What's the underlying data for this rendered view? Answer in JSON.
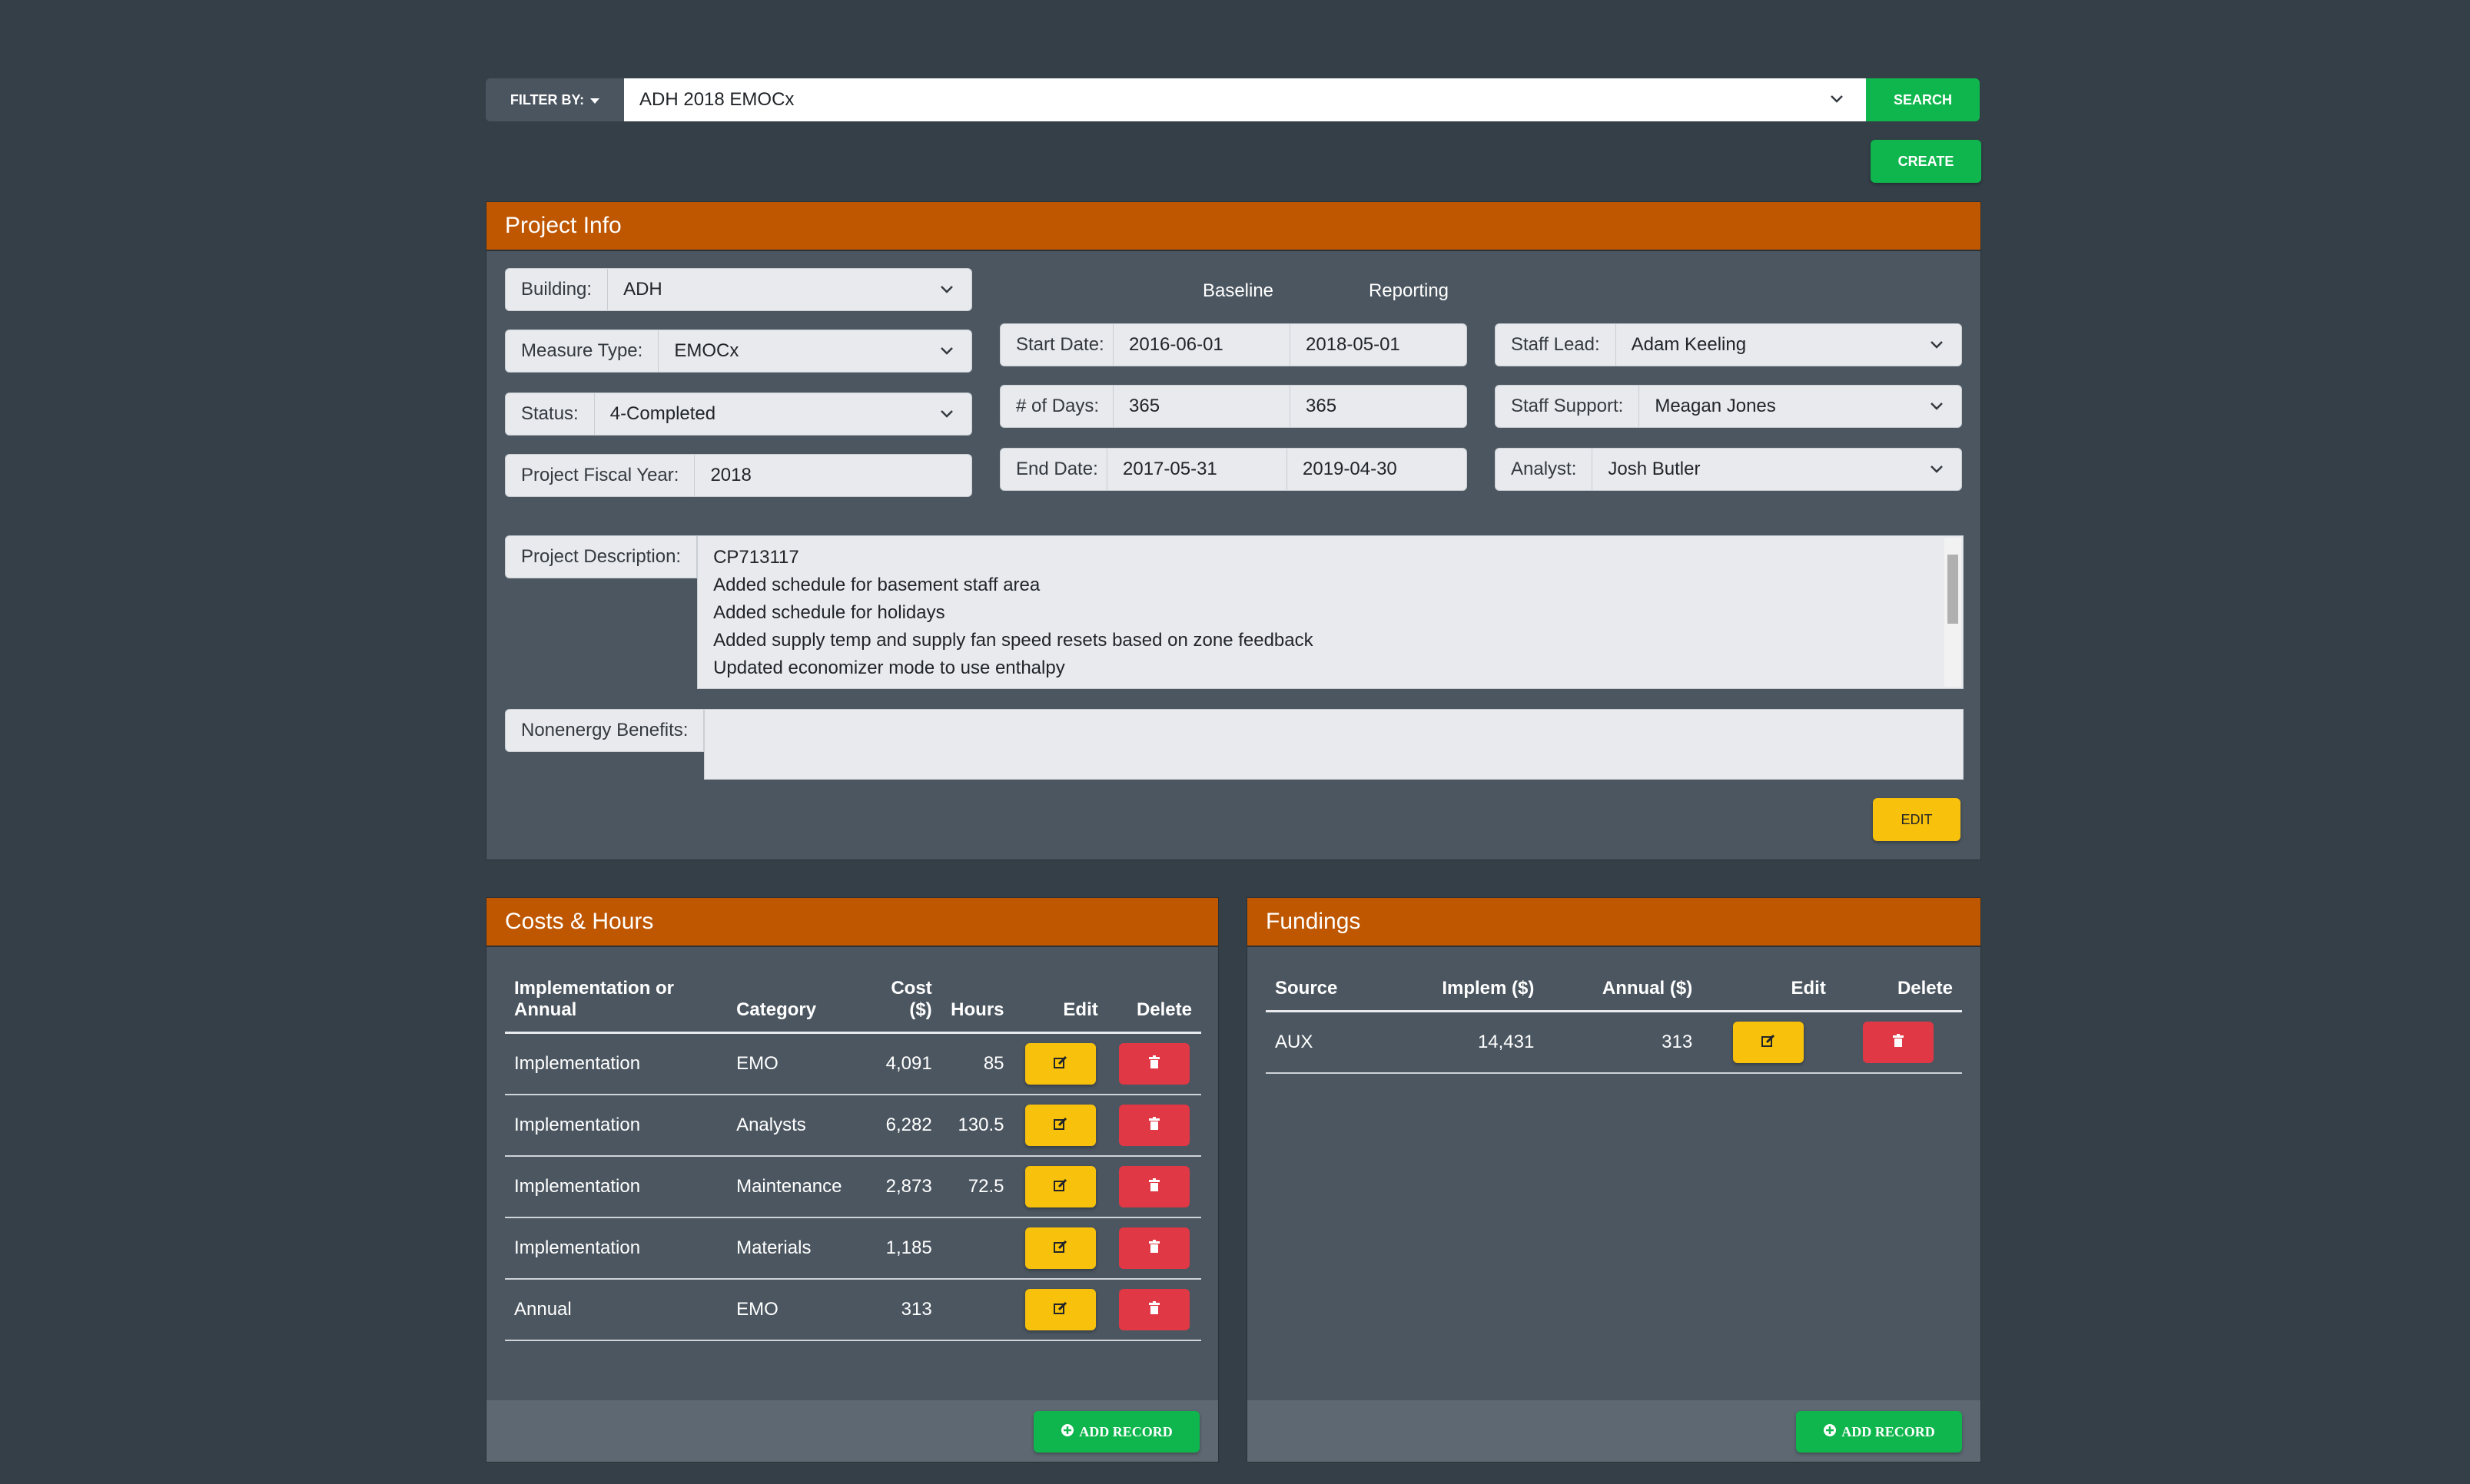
{
  "filter": {
    "label": "FILTER BY:",
    "value": "ADH 2018 EMOCx",
    "search_label": "SEARCH",
    "create_label": "CREATE"
  },
  "project_info": {
    "title": "Project Info",
    "building_label": "Building:",
    "building": "ADH",
    "measure_type_label": "Measure Type:",
    "measure_type": "EMOCx",
    "status_label": "Status:",
    "status": "4-Completed",
    "fiscal_year_label": "Project Fiscal Year:",
    "fiscal_year": "2018",
    "baseline_header": "Baseline",
    "reporting_header": "Reporting",
    "start_date_label": "Start Date:",
    "start_baseline": "2016-06-01",
    "start_reporting": "2018-05-01",
    "days_label": "# of Days:",
    "days_baseline": "365",
    "days_reporting": "365",
    "end_date_label": "End Date:",
    "end_baseline": "2017-05-31",
    "end_reporting": "2019-04-30",
    "staff_lead_label": "Staff Lead:",
    "staff_lead": "Adam Keeling",
    "staff_support_label": "Staff Support:",
    "staff_support": "Meagan Jones",
    "analyst_label": "Analyst:",
    "analyst": "Josh Butler",
    "description_label": "Project Description:",
    "description_lines": [
      "CP713117",
      "Added schedule for basement staff area",
      "Added schedule for holidays",
      "Added supply temp and supply fan speed resets based on zone feedback",
      "Updated economizer mode to use enthalpy"
    ],
    "nonenergy_label": "Nonenergy Benefits:",
    "nonenergy": "",
    "edit_label": "EDIT"
  },
  "costs": {
    "title": "Costs & Hours",
    "headers": [
      "Implementation or Annual",
      "Category",
      "Cost ($)",
      "Hours",
      "Edit",
      "Delete"
    ],
    "rows": [
      {
        "type": "Implementation",
        "category": "EMO",
        "cost": "4,091",
        "hours": "85"
      },
      {
        "type": "Implementation",
        "category": "Analysts",
        "cost": "6,282",
        "hours": "130.5"
      },
      {
        "type": "Implementation",
        "category": "Maintenance",
        "cost": "2,873",
        "hours": "72.5"
      },
      {
        "type": "Implementation",
        "category": "Materials",
        "cost": "1,185",
        "hours": ""
      },
      {
        "type": "Annual",
        "category": "EMO",
        "cost": "313",
        "hours": ""
      }
    ],
    "add_label": "ADD RECORD"
  },
  "fundings": {
    "title": "Fundings",
    "headers": [
      "Source",
      "Implem ($)",
      "Annual ($)",
      "Edit",
      "Delete"
    ],
    "rows": [
      {
        "source": "AUX",
        "implem": "14,431",
        "annual": "313"
      }
    ],
    "add_label": "ADD RECORD"
  },
  "colors": {
    "background": "#343f48",
    "card": "#4b5660",
    "header": "#bf5600",
    "success": "#0fb64d",
    "warning": "#f8c10b",
    "danger": "#e03845"
  }
}
